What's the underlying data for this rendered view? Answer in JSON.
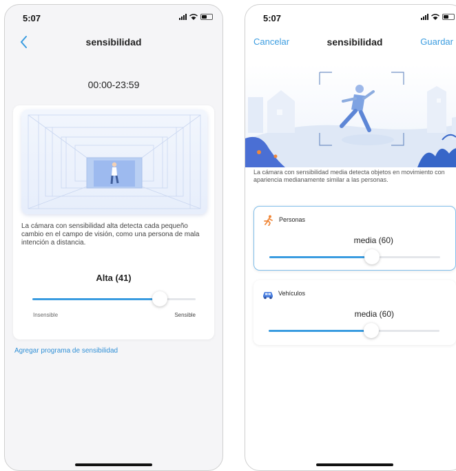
{
  "screen_left": {
    "status": {
      "time": "5:07"
    },
    "nav": {
      "title": "sensibilidad",
      "back_icon": "chevron-left-icon"
    },
    "time_range": "00:00-23:59",
    "description": "La cámara con sensibilidad alta detecta cada pequeño cambio en el campo de visión, como una persona de mala intención a distancia.",
    "level_title": "Alta (41)",
    "slider": {
      "value_fraction": 0.78,
      "min_label": "Insensible",
      "max_label": "Sensible"
    },
    "add_schedule_link": "Agregar programa de sensibilidad"
  },
  "screen_right": {
    "status": {
      "time": "5:07"
    },
    "nav": {
      "cancel": "Cancelar",
      "title": "sensibilidad",
      "save": "Guardar"
    },
    "description": "La cámara con sensibilidad media detecta objetos en movimiento con apariencia medianamente similar a las personas.",
    "categories": [
      {
        "label": "Personas",
        "icon": "running-person-icon",
        "value_label": "media (60)",
        "value_fraction": 0.6
      },
      {
        "label": "Vehículos",
        "icon": "car-icon",
        "value_label": "media (60)",
        "value_fraction": 0.6
      }
    ]
  },
  "colors": {
    "accent": "#3a9ce0",
    "track": "#e4e6ea",
    "selected_border": "#7fbde9"
  }
}
